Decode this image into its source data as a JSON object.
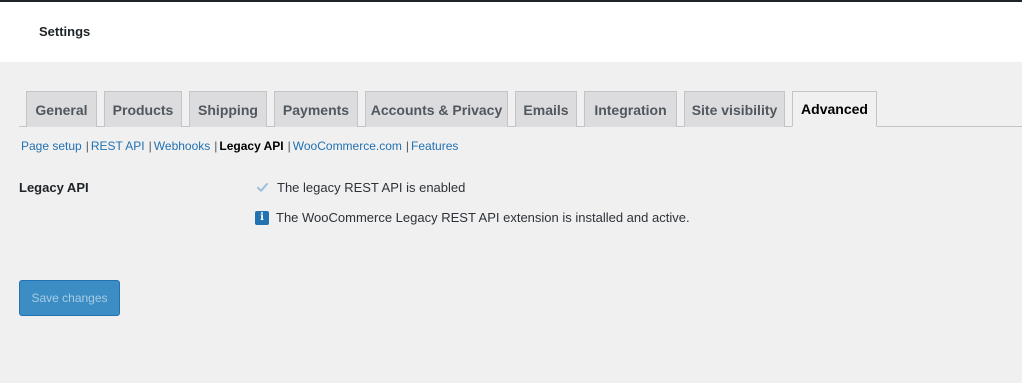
{
  "header": {
    "title": "Settings"
  },
  "tabs": [
    {
      "label": "General",
      "active": false
    },
    {
      "label": "Products",
      "active": false
    },
    {
      "label": "Shipping",
      "active": false
    },
    {
      "label": "Payments",
      "active": false
    },
    {
      "label": "Accounts & Privacy",
      "active": false
    },
    {
      "label": "Emails",
      "active": false
    },
    {
      "label": "Integration",
      "active": false
    },
    {
      "label": "Site visibility",
      "active": false
    },
    {
      "label": "Advanced",
      "active": true
    }
  ],
  "subnav": {
    "items": [
      {
        "label": "Page setup",
        "current": false
      },
      {
        "label": "REST API",
        "current": false
      },
      {
        "label": "Webhooks",
        "current": false
      },
      {
        "label": "Legacy API",
        "current": true
      },
      {
        "label": "WooCommerce.com",
        "current": false
      },
      {
        "label": "Features",
        "current": false
      }
    ],
    "separator": "|"
  },
  "legacy_api": {
    "label": "Legacy API",
    "checkbox_label": "The legacy REST API is enabled",
    "checkbox_checked": true,
    "info_icon_glyph": "i",
    "info_text": "The WooCommerce Legacy REST API extension is installed and active."
  },
  "save_button": {
    "label": "Save changes",
    "disabled": true
  },
  "colors": {
    "accent": "#2271b1",
    "tab_bg": "#dcdcde",
    "page_bg": "#f0f0f1"
  }
}
